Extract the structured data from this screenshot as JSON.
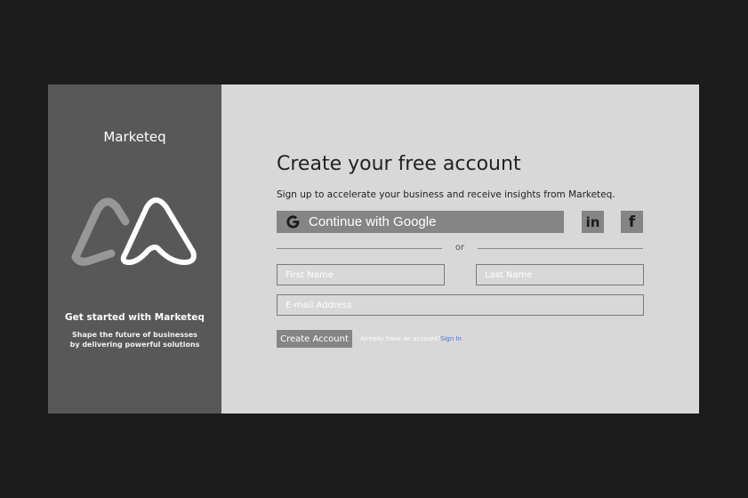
{
  "sidebar": {
    "brand": "Marketeq",
    "tagline": "Get started with Marketeq",
    "subline_1": "Shape the future of businesses",
    "subline_2": "by delivering powerful solutions"
  },
  "form": {
    "title": "Create your free account",
    "subtitle": "Sign up to accelerate your business and receive insights from Marketeq.",
    "google_label": "Continue with Google",
    "linkedin_label": "in",
    "facebook_label": "f",
    "divider_text": "or",
    "first_name_placeholder": "First Name",
    "last_name_placeholder": "Last Name",
    "email_placeholder": "E-mail Address",
    "create_label": "Create Account",
    "already_text": "Already have an account?",
    "signin_label": "Sign In"
  },
  "icons": {
    "google": "google-icon",
    "linkedin": "linkedin-icon",
    "facebook": "facebook-icon",
    "logo": "marketeq-logo"
  },
  "colors": {
    "background": "#1c1c1c",
    "sidebar": "#585858",
    "panel": "#d8d8d8",
    "button": "#858585",
    "link": "#4a6fd1"
  }
}
